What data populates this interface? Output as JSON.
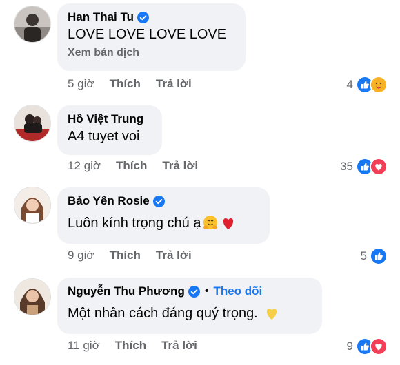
{
  "colors": {
    "accent": "#1877f2",
    "bubble": "#f0f2f5",
    "muted": "#65676b",
    "text": "#050505"
  },
  "comments": [
    {
      "author": "Han Thai Tu",
      "verified": true,
      "text": "LOVE LOVE LOVE LOVE",
      "translate": "Xem bản dịch",
      "time": "5 giờ",
      "like": "Thích",
      "reply": "Trả lời",
      "reaction_count": "4",
      "reactions": [
        "like-icon",
        "care-icon"
      ]
    },
    {
      "author": "Hồ Việt Trung",
      "verified": false,
      "text": "A4 tuyet voi",
      "time": "12 giờ",
      "like": "Thích",
      "reply": "Trả lời",
      "reaction_count": "35",
      "reactions": [
        "like-icon",
        "love-icon"
      ]
    },
    {
      "author": "Bảo Yến Rosie",
      "verified": true,
      "text": "Luôn kính trọng chú ạ",
      "emojis": [
        "hugging-face-emoji",
        "red-heart-emoji"
      ],
      "time": "9 giờ",
      "like": "Thích",
      "reply": "Trả lời",
      "reaction_count": "5",
      "reactions": [
        "like-icon"
      ]
    },
    {
      "author": "Nguyễn Thu Phương",
      "verified": true,
      "separator": "•",
      "follow": "Theo dõi",
      "text": "Một nhân cách đáng quý trọng.",
      "emojis": [
        "yellow-heart-emoji"
      ],
      "time": "11 giờ",
      "like": "Thích",
      "reply": "Trả lời",
      "reaction_count": "9",
      "reactions": [
        "like-icon",
        "love-icon"
      ]
    }
  ]
}
